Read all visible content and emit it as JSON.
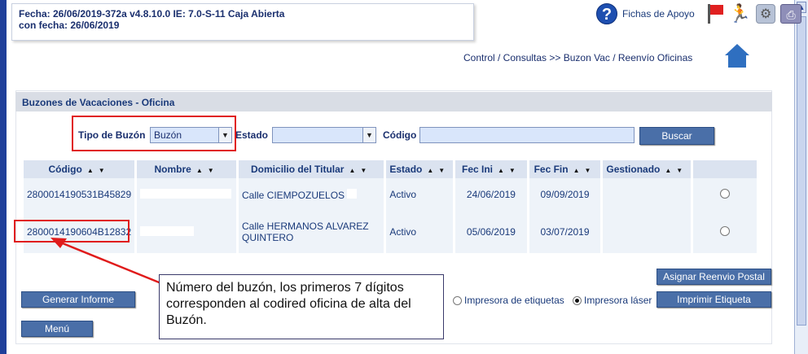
{
  "info": {
    "line1": "Fecha: 26/06/2019-372a v4.8.10.0  IE: 7.0-S-11  Caja Abierta",
    "line2": "con fecha: 26/06/2019"
  },
  "toolbar": {
    "help_label": "Fichas de Apoyo",
    "icons": [
      "help-icon",
      "flag-icon",
      "runner-icon",
      "gears-icon",
      "printer-icon"
    ]
  },
  "breadcrumb": "Control / Consultas >> Buzon Vac / Reenvío Oficinas",
  "panel": {
    "title": "Buzones de Vacaciones - Oficina"
  },
  "filters": {
    "tipo_label": "Tipo de Buzón",
    "tipo_value": "Buzón",
    "estado_label": "Estado",
    "estado_value": "",
    "codigo_label": "Código",
    "codigo_value": "",
    "buscar": "Buscar"
  },
  "table": {
    "headers": [
      "Código",
      "Nombre",
      "Domicilio del Titular",
      "Estado",
      "Fec Ini",
      "Fec Fin",
      "Gestionado"
    ],
    "rows": [
      {
        "codigo": "2800014190531B45829",
        "nombre": "",
        "domicilio": "Calle CIEMPOZUELOS",
        "estado": "Activo",
        "fec_ini": "24/06/2019",
        "fec_fin": "09/09/2019",
        "gestionado": ""
      },
      {
        "codigo": "2800014190604B12832",
        "nombre": "",
        "domicilio": "Calle HERMANOS ALVAREZ QUINTERO",
        "estado": "Activo",
        "fec_ini": "05/06/2019",
        "fec_fin": "03/07/2019",
        "gestionado": ""
      }
    ]
  },
  "actions": {
    "generar_informe": "Generar Informe",
    "menu": "Menú",
    "asignar_reenvio": "Asignar Reenvio Postal",
    "imprimir_etiqueta": "Imprimir Etiqueta",
    "impresora_etiquetas": "Impresora de etiquetas",
    "impresora_laser": "Impresora láser",
    "selected_printer": "Impresora láser"
  },
  "callout": "Número del buzón, los primeros 7 dígitos corresponden al codired oficina de alta del Buzón.",
  "colors": {
    "annotation": "#e01b1b",
    "button": "#4a6fa8",
    "header": "#d9dde5"
  }
}
